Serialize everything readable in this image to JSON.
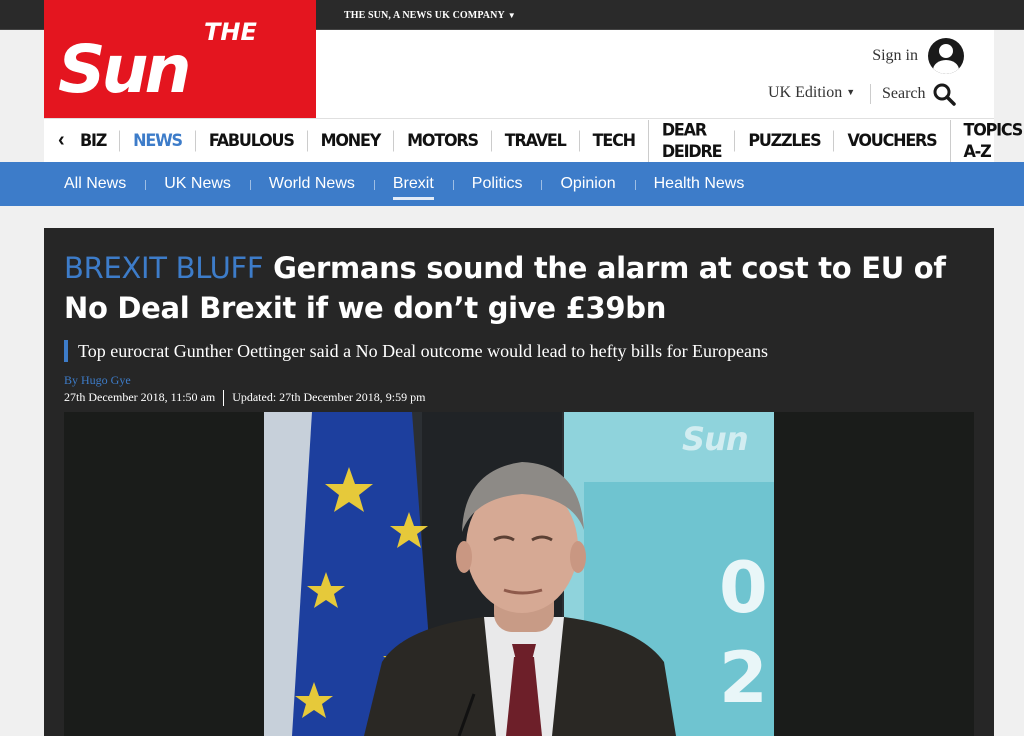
{
  "topbar": {
    "company_label": "THE SUN, A NEWS UK COMPANY"
  },
  "logo": {
    "text_top": "THE",
    "text_main": "Sun"
  },
  "header": {
    "sign_in": "Sign in",
    "edition": "UK Edition",
    "search": "Search"
  },
  "main_nav": {
    "items": [
      "BIZ",
      "NEWS",
      "FABULOUS",
      "MONEY",
      "MOTORS",
      "TRAVEL",
      "TECH",
      "DEAR DEIDRE",
      "PUZZLES",
      "VOUCHERS",
      "TOPICS A-Z"
    ],
    "active": "NEWS"
  },
  "sub_nav": {
    "items": [
      "All News",
      "UK News",
      "World News",
      "Brexit",
      "Politics",
      "Opinion",
      "Health News"
    ],
    "active": "Brexit"
  },
  "article": {
    "kicker": "BREXIT BLUFF",
    "headline": "Germans sound the alarm at cost to EU of No Deal Brexit if we don’t give £39bn",
    "standfirst": "Top eurocrat Gunther Oettinger said a No Deal outcome would lead to hefty bills for Europeans",
    "byline": "By Hugo Gye",
    "published": "27th December 2018, 11:50 am",
    "updated": "Updated: 27th December 2018, 9:59 pm"
  },
  "video": {
    "watermark": "Sun"
  },
  "colors": {
    "brand_red": "#e4151f",
    "accent_blue": "#3d7cc9",
    "article_bg": "#262626"
  }
}
